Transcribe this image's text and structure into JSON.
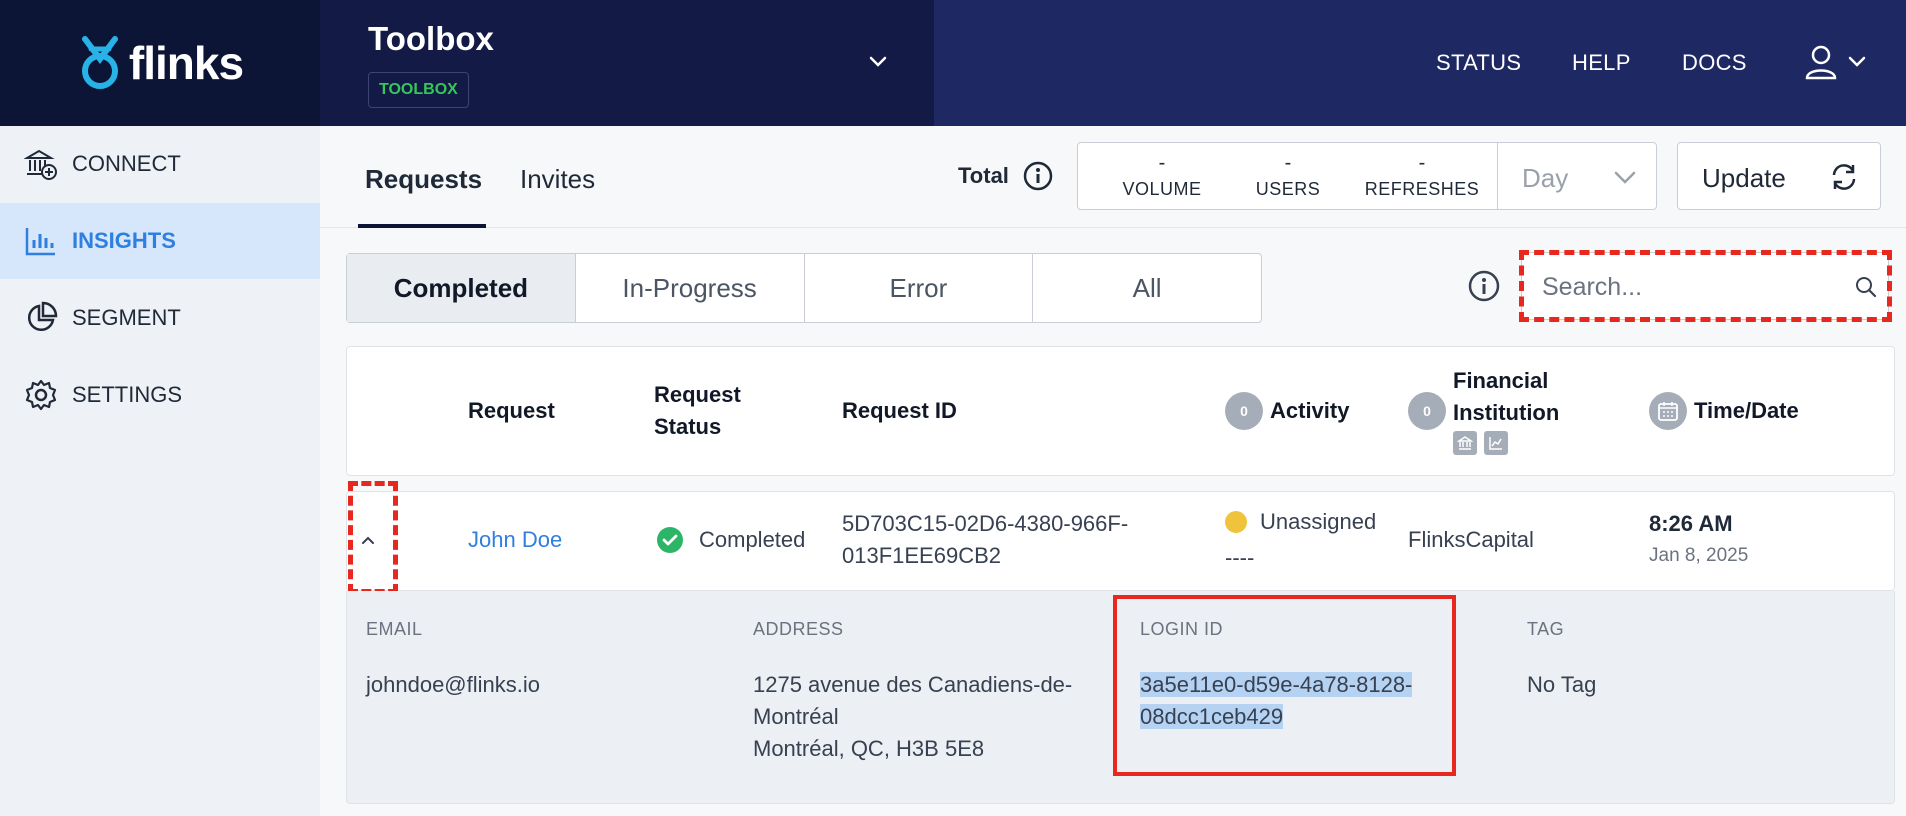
{
  "brand": {
    "name": "flinks"
  },
  "project": {
    "title": "Toolbox",
    "badge": "TOOLBOX"
  },
  "topnav": {
    "status": "STATUS",
    "help": "HELP",
    "docs": "DOCS"
  },
  "sidebar": {
    "items": [
      {
        "label": "CONNECT",
        "icon": "bank-plus-icon"
      },
      {
        "label": "INSIGHTS",
        "icon": "bar-chart-icon"
      },
      {
        "label": "SEGMENT",
        "icon": "pie-chart-icon"
      },
      {
        "label": "SETTINGS",
        "icon": "gear-icon"
      }
    ]
  },
  "tabs": [
    {
      "label": "Requests"
    },
    {
      "label": "Invites"
    }
  ],
  "totals": {
    "label": "Total",
    "volume_value": "-",
    "volume_label": "VOLUME",
    "users_value": "-",
    "users_label": "USERS",
    "refreshes_value": "-",
    "refreshes_label": "REFRESHES"
  },
  "period": {
    "selected": "Day"
  },
  "update_label": "Update",
  "filters": [
    "Completed",
    "In-Progress",
    "Error",
    "All"
  ],
  "search": {
    "placeholder": "Search..."
  },
  "table": {
    "headers": {
      "request": "Request",
      "request_status_1": "Request",
      "request_status_2": "Status",
      "request_id": "Request ID",
      "activity_count": "0",
      "activity": "Activity",
      "fi_count": "0",
      "fi_1": "Financial",
      "fi_2": "Institution",
      "time": "Time/Date"
    },
    "row": {
      "name": "John Doe",
      "status": "Completed",
      "request_id_1": "5D703C15-02D6-4380-966F-",
      "request_id_2": "013F1EE69CB2",
      "activity": "Unassigned",
      "activity_sub": "----",
      "institution": "FlinksCapital",
      "time": "8:26 AM",
      "date": "Jan 8, 2025"
    },
    "detail": {
      "email_label": "EMAIL",
      "email": "johndoe@flinks.io",
      "address_label": "ADDRESS",
      "address_1": "1275 avenue des Canadiens-de-",
      "address_2": "Montréal",
      "address_3": "Montréal, QC, H3B 5E8",
      "login_label": "LOGIN ID",
      "login_1": "3a5e11e0-d59e-4a78-8128-",
      "login_2": "08dcc1ceb429",
      "tag_label": "TAG",
      "tag": "No Tag"
    }
  },
  "colors": {
    "accent": "#2f7fe0",
    "success": "#34c759",
    "highlight": "#e8281e",
    "nav_bg": "#1e2863"
  }
}
